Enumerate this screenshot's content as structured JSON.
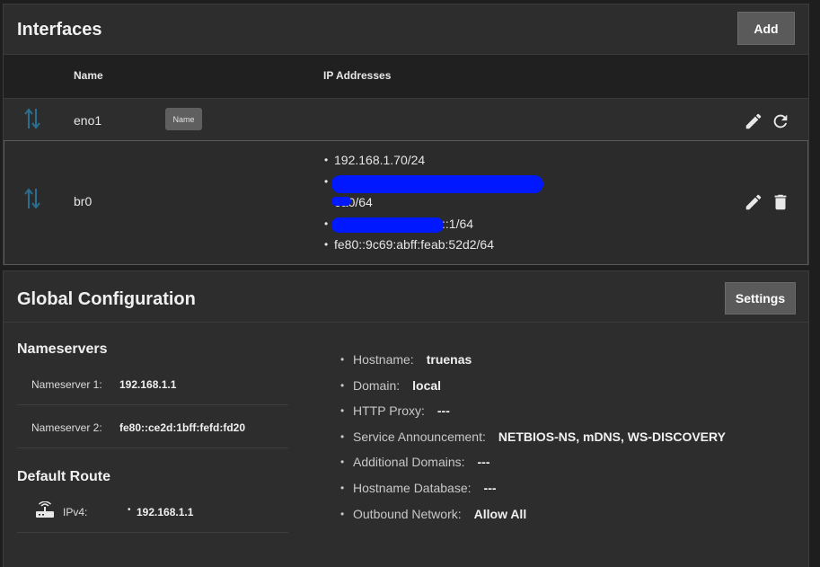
{
  "interfaces": {
    "title": "Interfaces",
    "add_label": "Add",
    "columns": {
      "name": "Name",
      "ip_addresses": "IP Addresses"
    },
    "rows": [
      {
        "name": "eno1",
        "chip": "Name",
        "ips": []
      },
      {
        "name": "br0",
        "ips": [
          "192.168.1.70/24",
          "",
          "6a0/64",
          "::1/64",
          "fe80::9c69:abff:feab:52d2/64"
        ]
      }
    ]
  },
  "global": {
    "title": "Global Configuration",
    "settings_label": "Settings",
    "nameservers_title": "Nameservers",
    "nameservers": [
      {
        "label": "Nameserver 1:",
        "value": "192.168.1.1"
      },
      {
        "label": "Nameserver 2:",
        "value": "fe80::ce2d:1bff:fefd:fd20"
      }
    ],
    "default_route_title": "Default Route",
    "ipv4_label": "IPv4:",
    "ipv4_value": "192.168.1.1",
    "config": [
      {
        "label": "Hostname:",
        "value": "truenas"
      },
      {
        "label": "Domain:",
        "value": "local"
      },
      {
        "label": "HTTP Proxy:",
        "value": "---"
      },
      {
        "label": "Service Announcement:",
        "value": "NETBIOS-NS, mDNS, WS-DISCOVERY"
      },
      {
        "label": "Additional Domains:",
        "value": "---"
      },
      {
        "label": "Hostname Database:",
        "value": "---"
      },
      {
        "label": "Outbound Network:",
        "value": "Allow All"
      }
    ]
  },
  "colors": {
    "accent": "#2a6f8f",
    "redaction": "#0018ff",
    "button": "#5a5a5a"
  }
}
